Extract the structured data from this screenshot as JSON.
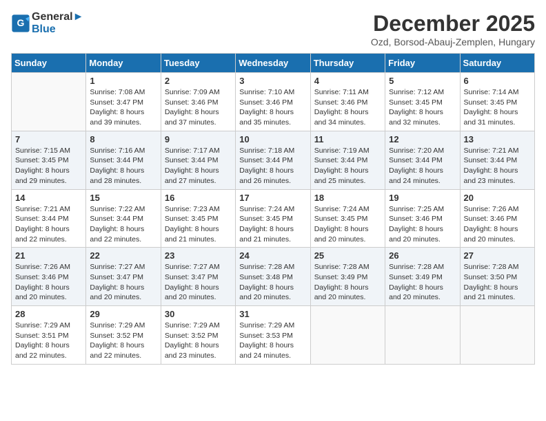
{
  "header": {
    "logo_line1": "General",
    "logo_line2": "Blue",
    "month_title": "December 2025",
    "subtitle": "Ozd, Borsod-Abauj-Zemplen, Hungary"
  },
  "days_of_week": [
    "Sunday",
    "Monday",
    "Tuesday",
    "Wednesday",
    "Thursday",
    "Friday",
    "Saturday"
  ],
  "weeks": [
    [
      {
        "day": "",
        "info": ""
      },
      {
        "day": "1",
        "info": "Sunrise: 7:08 AM\nSunset: 3:47 PM\nDaylight: 8 hours\nand 39 minutes."
      },
      {
        "day": "2",
        "info": "Sunrise: 7:09 AM\nSunset: 3:46 PM\nDaylight: 8 hours\nand 37 minutes."
      },
      {
        "day": "3",
        "info": "Sunrise: 7:10 AM\nSunset: 3:46 PM\nDaylight: 8 hours\nand 35 minutes."
      },
      {
        "day": "4",
        "info": "Sunrise: 7:11 AM\nSunset: 3:46 PM\nDaylight: 8 hours\nand 34 minutes."
      },
      {
        "day": "5",
        "info": "Sunrise: 7:12 AM\nSunset: 3:45 PM\nDaylight: 8 hours\nand 32 minutes."
      },
      {
        "day": "6",
        "info": "Sunrise: 7:14 AM\nSunset: 3:45 PM\nDaylight: 8 hours\nand 31 minutes."
      }
    ],
    [
      {
        "day": "7",
        "info": "Sunrise: 7:15 AM\nSunset: 3:45 PM\nDaylight: 8 hours\nand 29 minutes."
      },
      {
        "day": "8",
        "info": "Sunrise: 7:16 AM\nSunset: 3:44 PM\nDaylight: 8 hours\nand 28 minutes."
      },
      {
        "day": "9",
        "info": "Sunrise: 7:17 AM\nSunset: 3:44 PM\nDaylight: 8 hours\nand 27 minutes."
      },
      {
        "day": "10",
        "info": "Sunrise: 7:18 AM\nSunset: 3:44 PM\nDaylight: 8 hours\nand 26 minutes."
      },
      {
        "day": "11",
        "info": "Sunrise: 7:19 AM\nSunset: 3:44 PM\nDaylight: 8 hours\nand 25 minutes."
      },
      {
        "day": "12",
        "info": "Sunrise: 7:20 AM\nSunset: 3:44 PM\nDaylight: 8 hours\nand 24 minutes."
      },
      {
        "day": "13",
        "info": "Sunrise: 7:21 AM\nSunset: 3:44 PM\nDaylight: 8 hours\nand 23 minutes."
      }
    ],
    [
      {
        "day": "14",
        "info": "Sunrise: 7:21 AM\nSunset: 3:44 PM\nDaylight: 8 hours\nand 22 minutes."
      },
      {
        "day": "15",
        "info": "Sunrise: 7:22 AM\nSunset: 3:44 PM\nDaylight: 8 hours\nand 22 minutes."
      },
      {
        "day": "16",
        "info": "Sunrise: 7:23 AM\nSunset: 3:45 PM\nDaylight: 8 hours\nand 21 minutes."
      },
      {
        "day": "17",
        "info": "Sunrise: 7:24 AM\nSunset: 3:45 PM\nDaylight: 8 hours\nand 21 minutes."
      },
      {
        "day": "18",
        "info": "Sunrise: 7:24 AM\nSunset: 3:45 PM\nDaylight: 8 hours\nand 20 minutes."
      },
      {
        "day": "19",
        "info": "Sunrise: 7:25 AM\nSunset: 3:46 PM\nDaylight: 8 hours\nand 20 minutes."
      },
      {
        "day": "20",
        "info": "Sunrise: 7:26 AM\nSunset: 3:46 PM\nDaylight: 8 hours\nand 20 minutes."
      }
    ],
    [
      {
        "day": "21",
        "info": "Sunrise: 7:26 AM\nSunset: 3:46 PM\nDaylight: 8 hours\nand 20 minutes."
      },
      {
        "day": "22",
        "info": "Sunrise: 7:27 AM\nSunset: 3:47 PM\nDaylight: 8 hours\nand 20 minutes."
      },
      {
        "day": "23",
        "info": "Sunrise: 7:27 AM\nSunset: 3:47 PM\nDaylight: 8 hours\nand 20 minutes."
      },
      {
        "day": "24",
        "info": "Sunrise: 7:28 AM\nSunset: 3:48 PM\nDaylight: 8 hours\nand 20 minutes."
      },
      {
        "day": "25",
        "info": "Sunrise: 7:28 AM\nSunset: 3:49 PM\nDaylight: 8 hours\nand 20 minutes."
      },
      {
        "day": "26",
        "info": "Sunrise: 7:28 AM\nSunset: 3:49 PM\nDaylight: 8 hours\nand 20 minutes."
      },
      {
        "day": "27",
        "info": "Sunrise: 7:28 AM\nSunset: 3:50 PM\nDaylight: 8 hours\nand 21 minutes."
      }
    ],
    [
      {
        "day": "28",
        "info": "Sunrise: 7:29 AM\nSunset: 3:51 PM\nDaylight: 8 hours\nand 22 minutes."
      },
      {
        "day": "29",
        "info": "Sunrise: 7:29 AM\nSunset: 3:52 PM\nDaylight: 8 hours\nand 22 minutes."
      },
      {
        "day": "30",
        "info": "Sunrise: 7:29 AM\nSunset: 3:52 PM\nDaylight: 8 hours\nand 23 minutes."
      },
      {
        "day": "31",
        "info": "Sunrise: 7:29 AM\nSunset: 3:53 PM\nDaylight: 8 hours\nand 24 minutes."
      },
      {
        "day": "",
        "info": ""
      },
      {
        "day": "",
        "info": ""
      },
      {
        "day": "",
        "info": ""
      }
    ]
  ]
}
